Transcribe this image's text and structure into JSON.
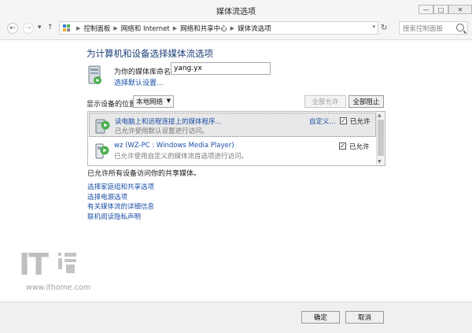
{
  "window": {
    "title": "媒体流选项"
  },
  "nav": {
    "breadcrumbs": [
      "控制面板",
      "网络和 Internet",
      "网络和共享中心",
      "媒体流选项"
    ],
    "search_placeholder": "搜索控制面板"
  },
  "page": {
    "heading": "为计算机和设备选择媒体流选项",
    "library_name_label": "为你的媒体库命名:",
    "library_name_value": "yang.yx",
    "default_settings_link": "选择默认设置...",
    "show_devices_label": "显示设备的位置:",
    "location_selected": "本地网络",
    "allow_all_button": "全部允许",
    "block_all_button": "全部阻止",
    "devices": [
      {
        "title": "读电脑上和远程连接上的媒体程序...",
        "description": "已允许使用默认设置进行访问。",
        "customize": "自定义...",
        "allowed_label": "已允许",
        "checked": true,
        "icon": "media-device-icon"
      },
      {
        "title": "wz (WZ-PC : Windows Media Player)",
        "description": "已允许使用自定义的媒体流首选项进行访问。",
        "customize": "",
        "allowed_label": "已允许",
        "checked": true,
        "icon": "media-player-device-icon"
      }
    ],
    "all_allowed_text": "已允许所有设备访问你的共享媒体。",
    "links": [
      "选择家庭组和共享选项",
      "选择电源选项",
      "有关媒体流的详细信息",
      "联机阅读隐私声明"
    ]
  },
  "watermark": {
    "brand": "IT",
    "url": "www.ithome.com"
  },
  "footer": {
    "ok_label": "确定",
    "cancel_label": "取消"
  },
  "colors": {
    "heading": "#1e3f78",
    "link": "#1b4fa8",
    "title_bar": "#f5f5f5"
  }
}
